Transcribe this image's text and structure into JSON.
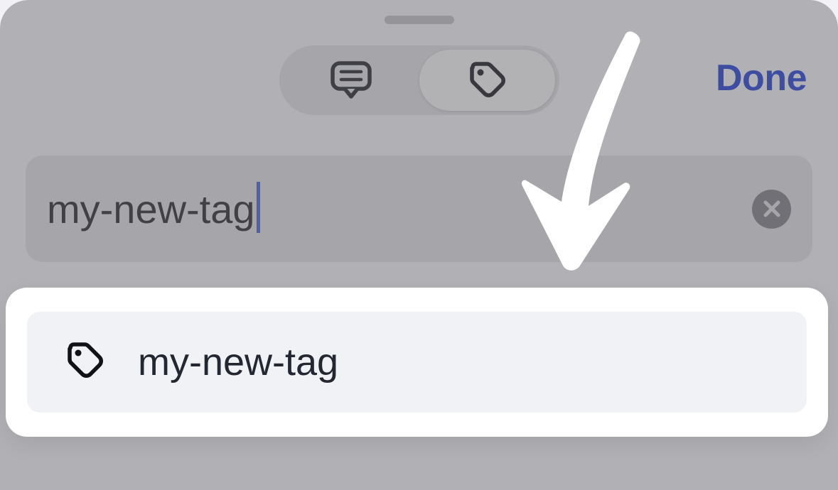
{
  "header": {
    "done_label": "Done"
  },
  "search": {
    "value": "my-new-tag"
  },
  "suggestions": [
    {
      "label": "my-new-tag"
    }
  ]
}
